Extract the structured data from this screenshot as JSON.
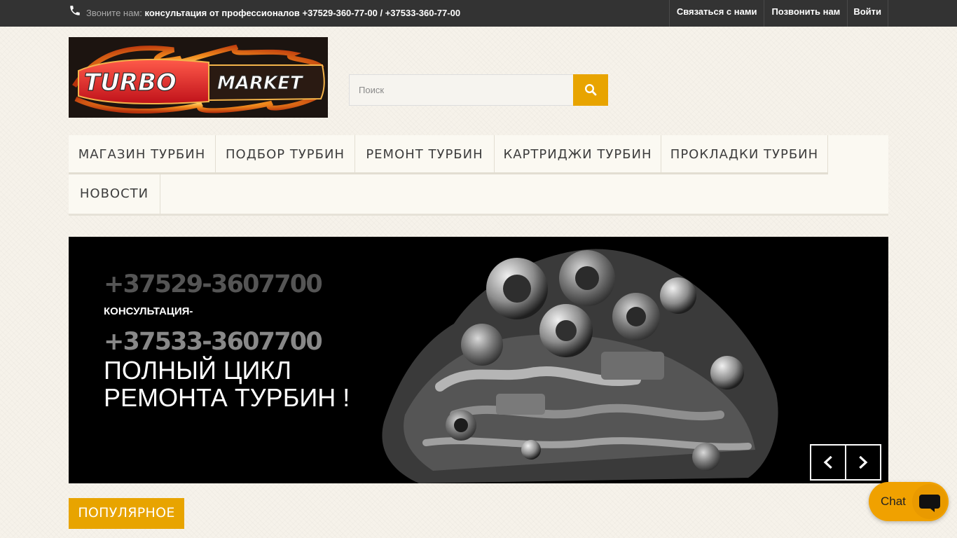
{
  "topbar": {
    "call_label": "Звоните нам:",
    "call_value": "консультация от профессионалов +37529-360-77-00 / +37533-360-77-00",
    "links": [
      "Связаться с нами",
      "Позвонить нам",
      "Войти"
    ]
  },
  "logo": {
    "text_left": "TURBO",
    "text_right": "MARKET"
  },
  "search": {
    "placeholder": "Поиск"
  },
  "menu": {
    "items": [
      "МАГАЗИН ТУРБИН",
      "ПОДБОР ТУРБИН",
      "РЕМОНТ ТУРБИН",
      "КАРТРИДЖИ ТУРБИН",
      "ПРОКЛАДКИ ТУРБИН",
      "НОВОСТИ"
    ]
  },
  "slider": {
    "phone1": "+37529-3607700",
    "consult": "КОНСУЛЬТАЦИЯ-",
    "phone2": "+37533-3607700",
    "line1": "ПОЛНЫЙ ЦИКЛ",
    "line2": "РЕМОНТА ТУРБИН !"
  },
  "popular": {
    "label": "ПОПУЛЯРНОЕ"
  },
  "chat": {
    "label": "Chat"
  },
  "colors": {
    "accent": "#e8a400",
    "topbar": "#333333",
    "slider_bg": "#000000"
  }
}
